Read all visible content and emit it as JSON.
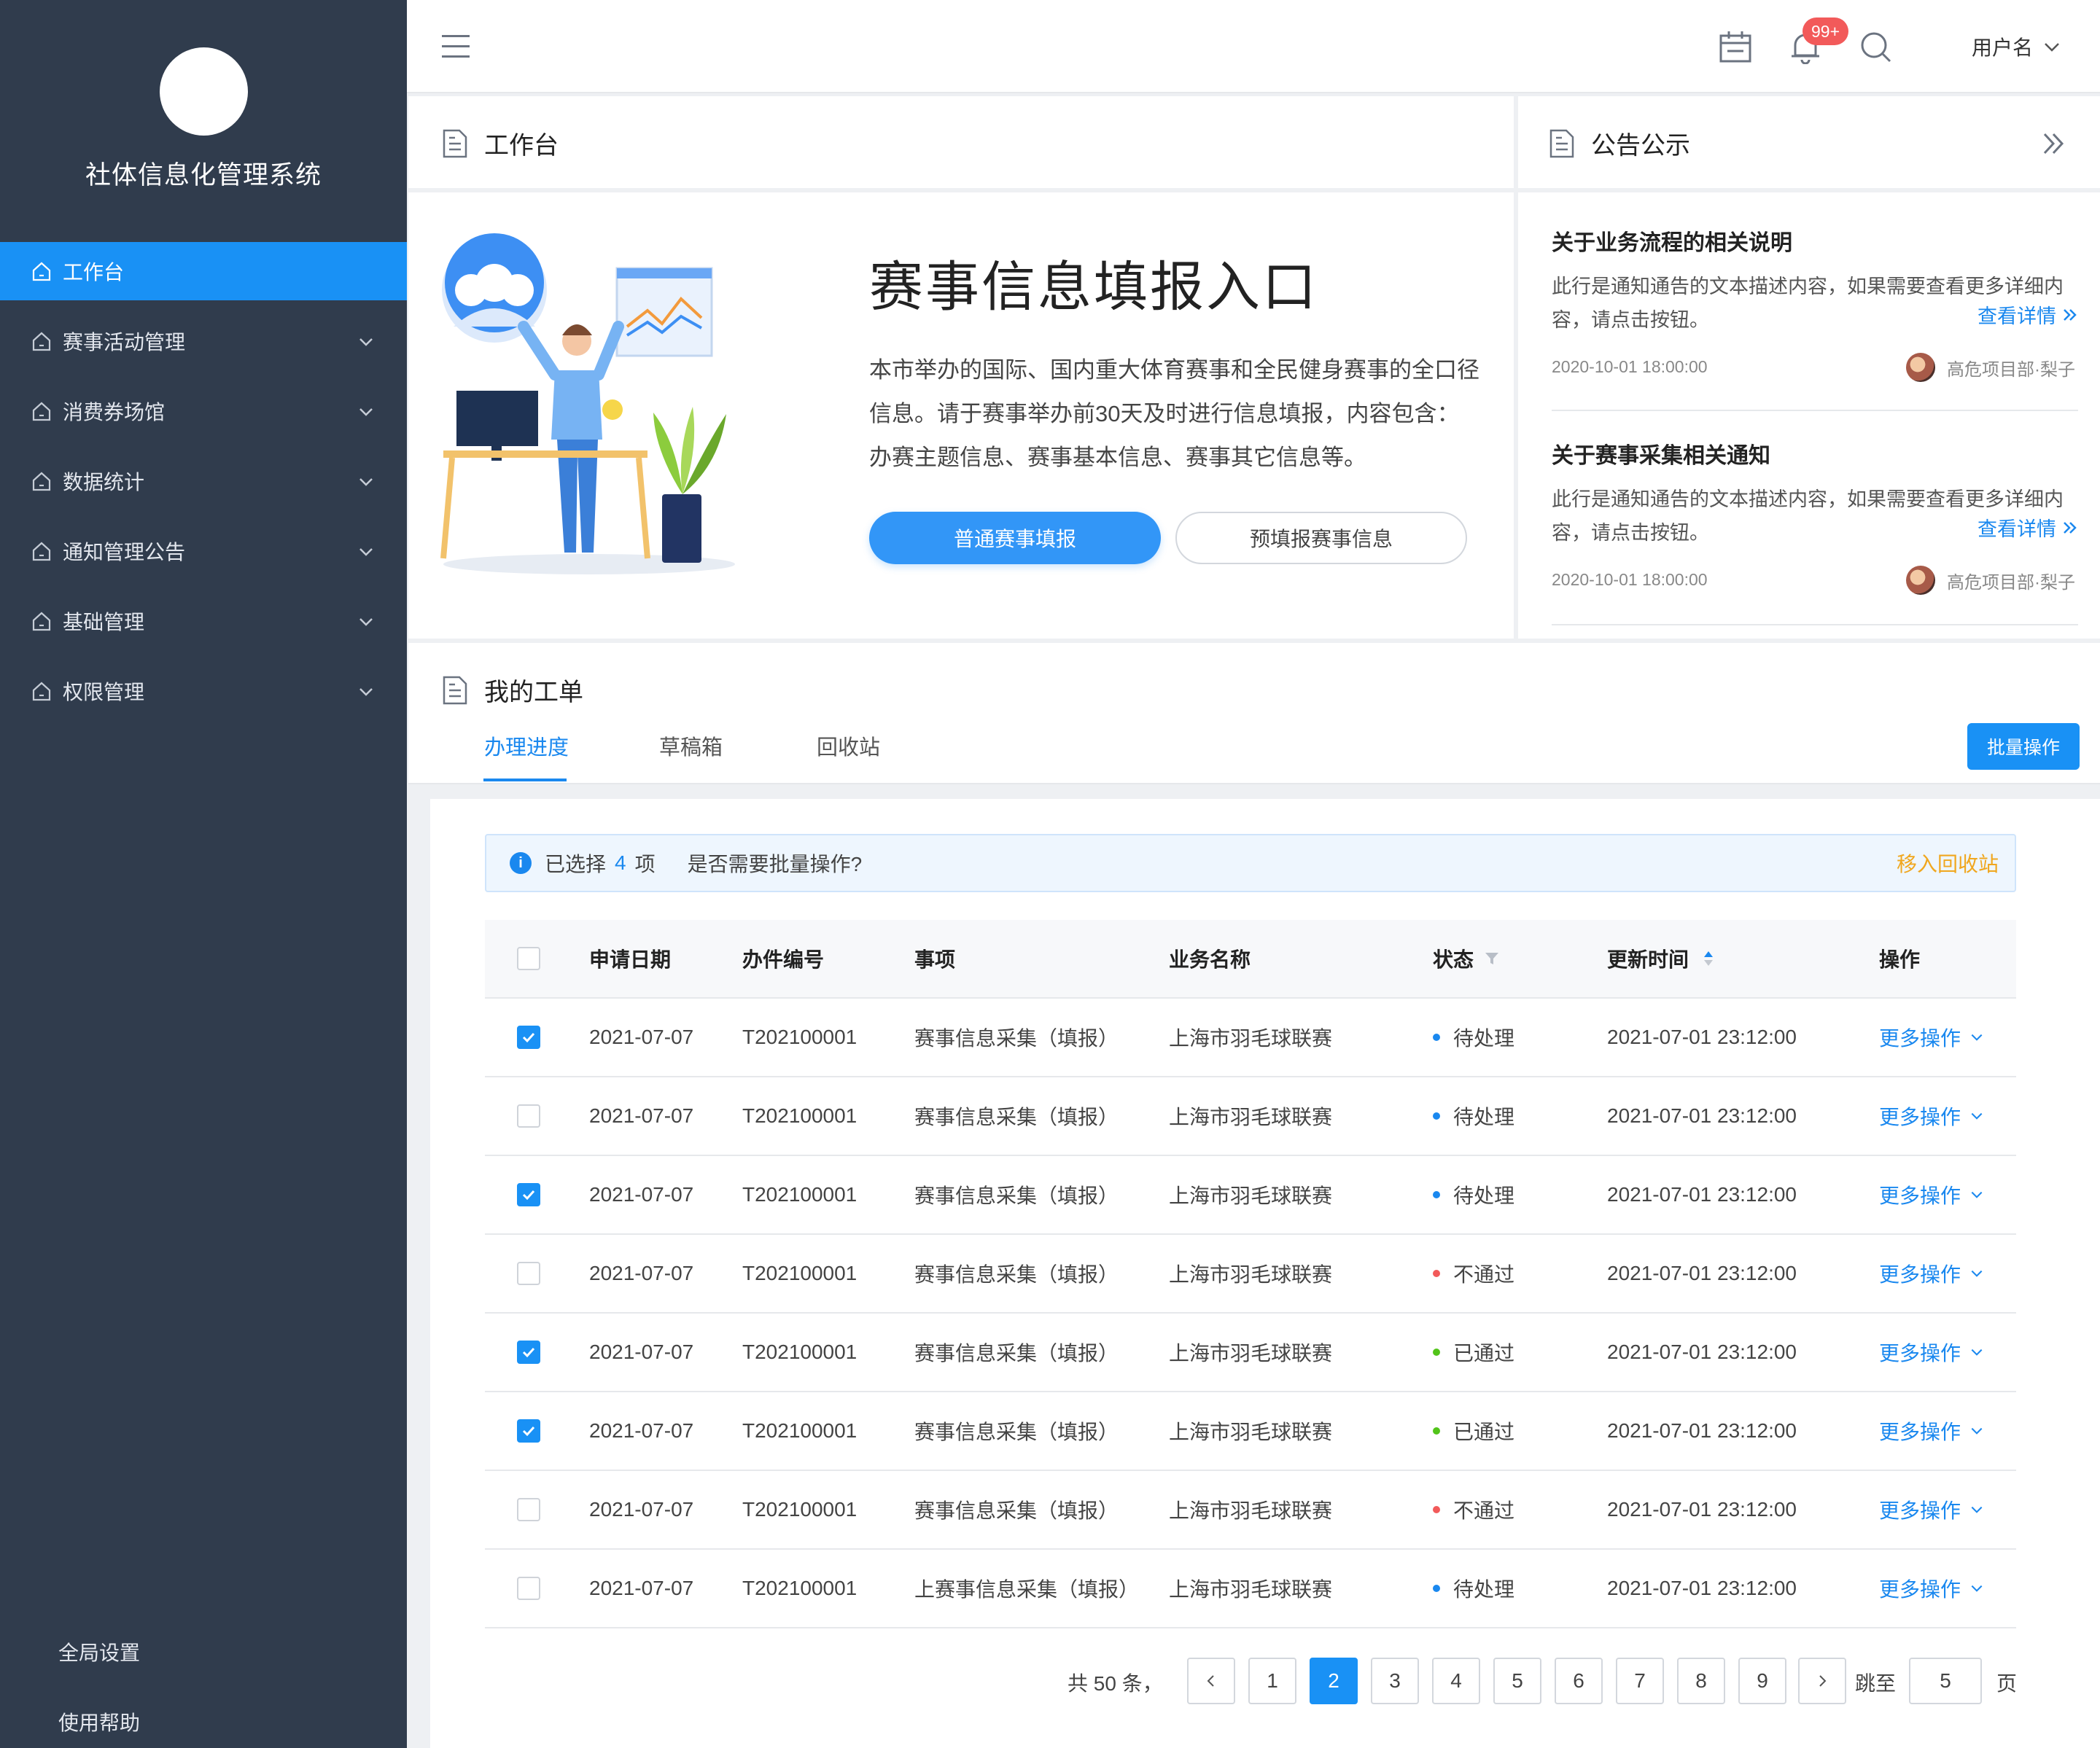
{
  "app": {
    "system_title": "社体信息化管理系统"
  },
  "sidebar": {
    "items": [
      {
        "label": "工作台",
        "active": true,
        "expandable": false
      },
      {
        "label": "赛事活动管理",
        "active": false,
        "expandable": true
      },
      {
        "label": "消费券场馆",
        "active": false,
        "expandable": true
      },
      {
        "label": "数据统计",
        "active": false,
        "expandable": true
      },
      {
        "label": "通知管理公告",
        "active": false,
        "expandable": true
      },
      {
        "label": "基础管理",
        "active": false,
        "expandable": true
      },
      {
        "label": "权限管理",
        "active": false,
        "expandable": true
      }
    ],
    "bottom": {
      "settings": "全局设置",
      "help": "使用帮助"
    }
  },
  "topbar": {
    "badge": "99+",
    "username": "用户名",
    "icons": [
      "menu-icon",
      "calendar-icon",
      "bell-icon",
      "search-icon",
      "chevron-down-icon"
    ]
  },
  "workbench": {
    "title": "工作台",
    "hero_title": "赛事信息填报入口",
    "hero_desc": "本市举办的国际、国内重大体育赛事和全民健身赛事的全口径信息。请于赛事举办前30天及时进行信息填报，内容包含：办赛主题信息、赛事基本信息、赛事其它信息等。",
    "primary_button": "普通赛事填报",
    "secondary_button": "预填报赛事信息"
  },
  "notices": {
    "title": "公告公示",
    "items": [
      {
        "title": "关于业务流程的相关说明",
        "text": "此行是通知通告的文本描述内容，如果需要查看更多详细内容，请点击按钮。",
        "more": "查看详情",
        "date": "2020-10-01 18:00:00",
        "author": "高危项目部·梨子"
      },
      {
        "title": "关于赛事采集相关通知",
        "text": "此行是通知通告的文本描述内容，如果需要查看更多详细内容，请点击按钮。",
        "more": "查看详情",
        "date": "2020-10-01 18:00:00",
        "author": "高危项目部·梨子"
      }
    ]
  },
  "orders": {
    "title": "我的工单",
    "tabs": [
      "办理进度",
      "草稿箱",
      "回收站"
    ],
    "active_tab": 0,
    "batch_button": "批量操作",
    "alert": {
      "prefix": "已选择",
      "count": "4",
      "suffix": "项",
      "question": "是否需要批量操作?",
      "action": "移入回收站"
    },
    "columns": [
      "申请日期",
      "办件编号",
      "事项",
      "业务名称",
      "状态",
      "更新时间",
      "操作"
    ],
    "rows": [
      {
        "checked": true,
        "date": "2021-07-07",
        "no": "T202100001",
        "item": "赛事信息采集（填报）",
        "biz": "上海市羽毛球联赛",
        "status": "待处理",
        "status_color": "#1a88ef",
        "updated": "2021-07-01  23:12:00",
        "op": "更多操作"
      },
      {
        "checked": false,
        "date": "2021-07-07",
        "no": "T202100001",
        "item": "赛事信息采集（填报）",
        "biz": "上海市羽毛球联赛",
        "status": "待处理",
        "status_color": "#1a88ef",
        "updated": "2021-07-01  23:12:00",
        "op": "更多操作"
      },
      {
        "checked": true,
        "date": "2021-07-07",
        "no": "T202100001",
        "item": "赛事信息采集（填报）",
        "biz": "上海市羽毛球联赛",
        "status": "待处理",
        "status_color": "#1a88ef",
        "updated": "2021-07-01  23:12:00",
        "op": "更多操作"
      },
      {
        "checked": false,
        "date": "2021-07-07",
        "no": "T202100001",
        "item": "赛事信息采集（填报）",
        "biz": "上海市羽毛球联赛",
        "status": "不通过",
        "status_color": "#f25a5a",
        "updated": "2021-07-01  23:12:00",
        "op": "更多操作"
      },
      {
        "checked": true,
        "date": "2021-07-07",
        "no": "T202100001",
        "item": "赛事信息采集（填报）",
        "biz": "上海市羽毛球联赛",
        "status": "已通过",
        "status_color": "#52c41a",
        "updated": "2021-07-01  23:12:00",
        "op": "更多操作"
      },
      {
        "checked": true,
        "date": "2021-07-07",
        "no": "T202100001",
        "item": "赛事信息采集（填报）",
        "biz": "上海市羽毛球联赛",
        "status": "已通过",
        "status_color": "#52c41a",
        "updated": "2021-07-01  23:12:00",
        "op": "更多操作"
      },
      {
        "checked": false,
        "date": "2021-07-07",
        "no": "T202100001",
        "item": "赛事信息采集（填报）",
        "biz": "上海市羽毛球联赛",
        "status": "不通过",
        "status_color": "#f25a5a",
        "updated": "2021-07-01  23:12:00",
        "op": "更多操作"
      },
      {
        "checked": false,
        "date": "2021-07-07",
        "no": "T202100001",
        "item": "上赛事信息采集（填报）",
        "biz": "上海市羽毛球联赛",
        "status": "待处理",
        "status_color": "#1a88ef",
        "updated": "2021-07-01  23:12:00",
        "op": "更多操作"
      }
    ],
    "pagination": {
      "total_text": "共 50 条，",
      "pages": [
        "1",
        "2",
        "3",
        "4",
        "5",
        "6",
        "7",
        "8",
        "9"
      ],
      "current": "2",
      "jump_label": "跳至",
      "jump_value": "5",
      "page_suffix": "页"
    }
  }
}
